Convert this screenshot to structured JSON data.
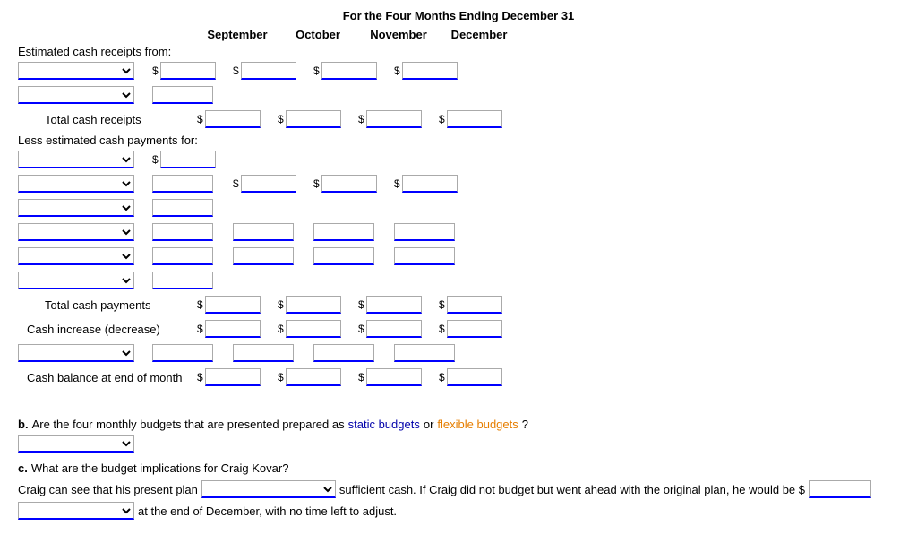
{
  "title": "For the Four Months Ending December 31",
  "columns": [
    "September",
    "October",
    "November",
    "December"
  ],
  "sections": {
    "receipts_label": "Estimated cash receipts from:",
    "total_receipts": "Total cash receipts",
    "payments_label": "Less estimated cash payments for:",
    "total_payments": "Total cash payments",
    "cash_increase": "Cash increase (decrease)",
    "cash_balance": "Cash balance at end of month"
  },
  "section_b": {
    "label": "b.",
    "text1": "Are the four monthly budgets that are presented prepared as",
    "link1": "static budgets",
    "text2": "or",
    "link2": "flexible budgets",
    "text3": "?"
  },
  "section_c": {
    "label": "c.",
    "text": "What are the budget implications for Craig Kovar?"
  },
  "craig_text1": "Craig can see that his present plan",
  "craig_text2": "sufficient cash. If Craig did not budget but went ahead with the original plan, he would be $",
  "craig_text3": "at the end of December, with no time left to adjust."
}
